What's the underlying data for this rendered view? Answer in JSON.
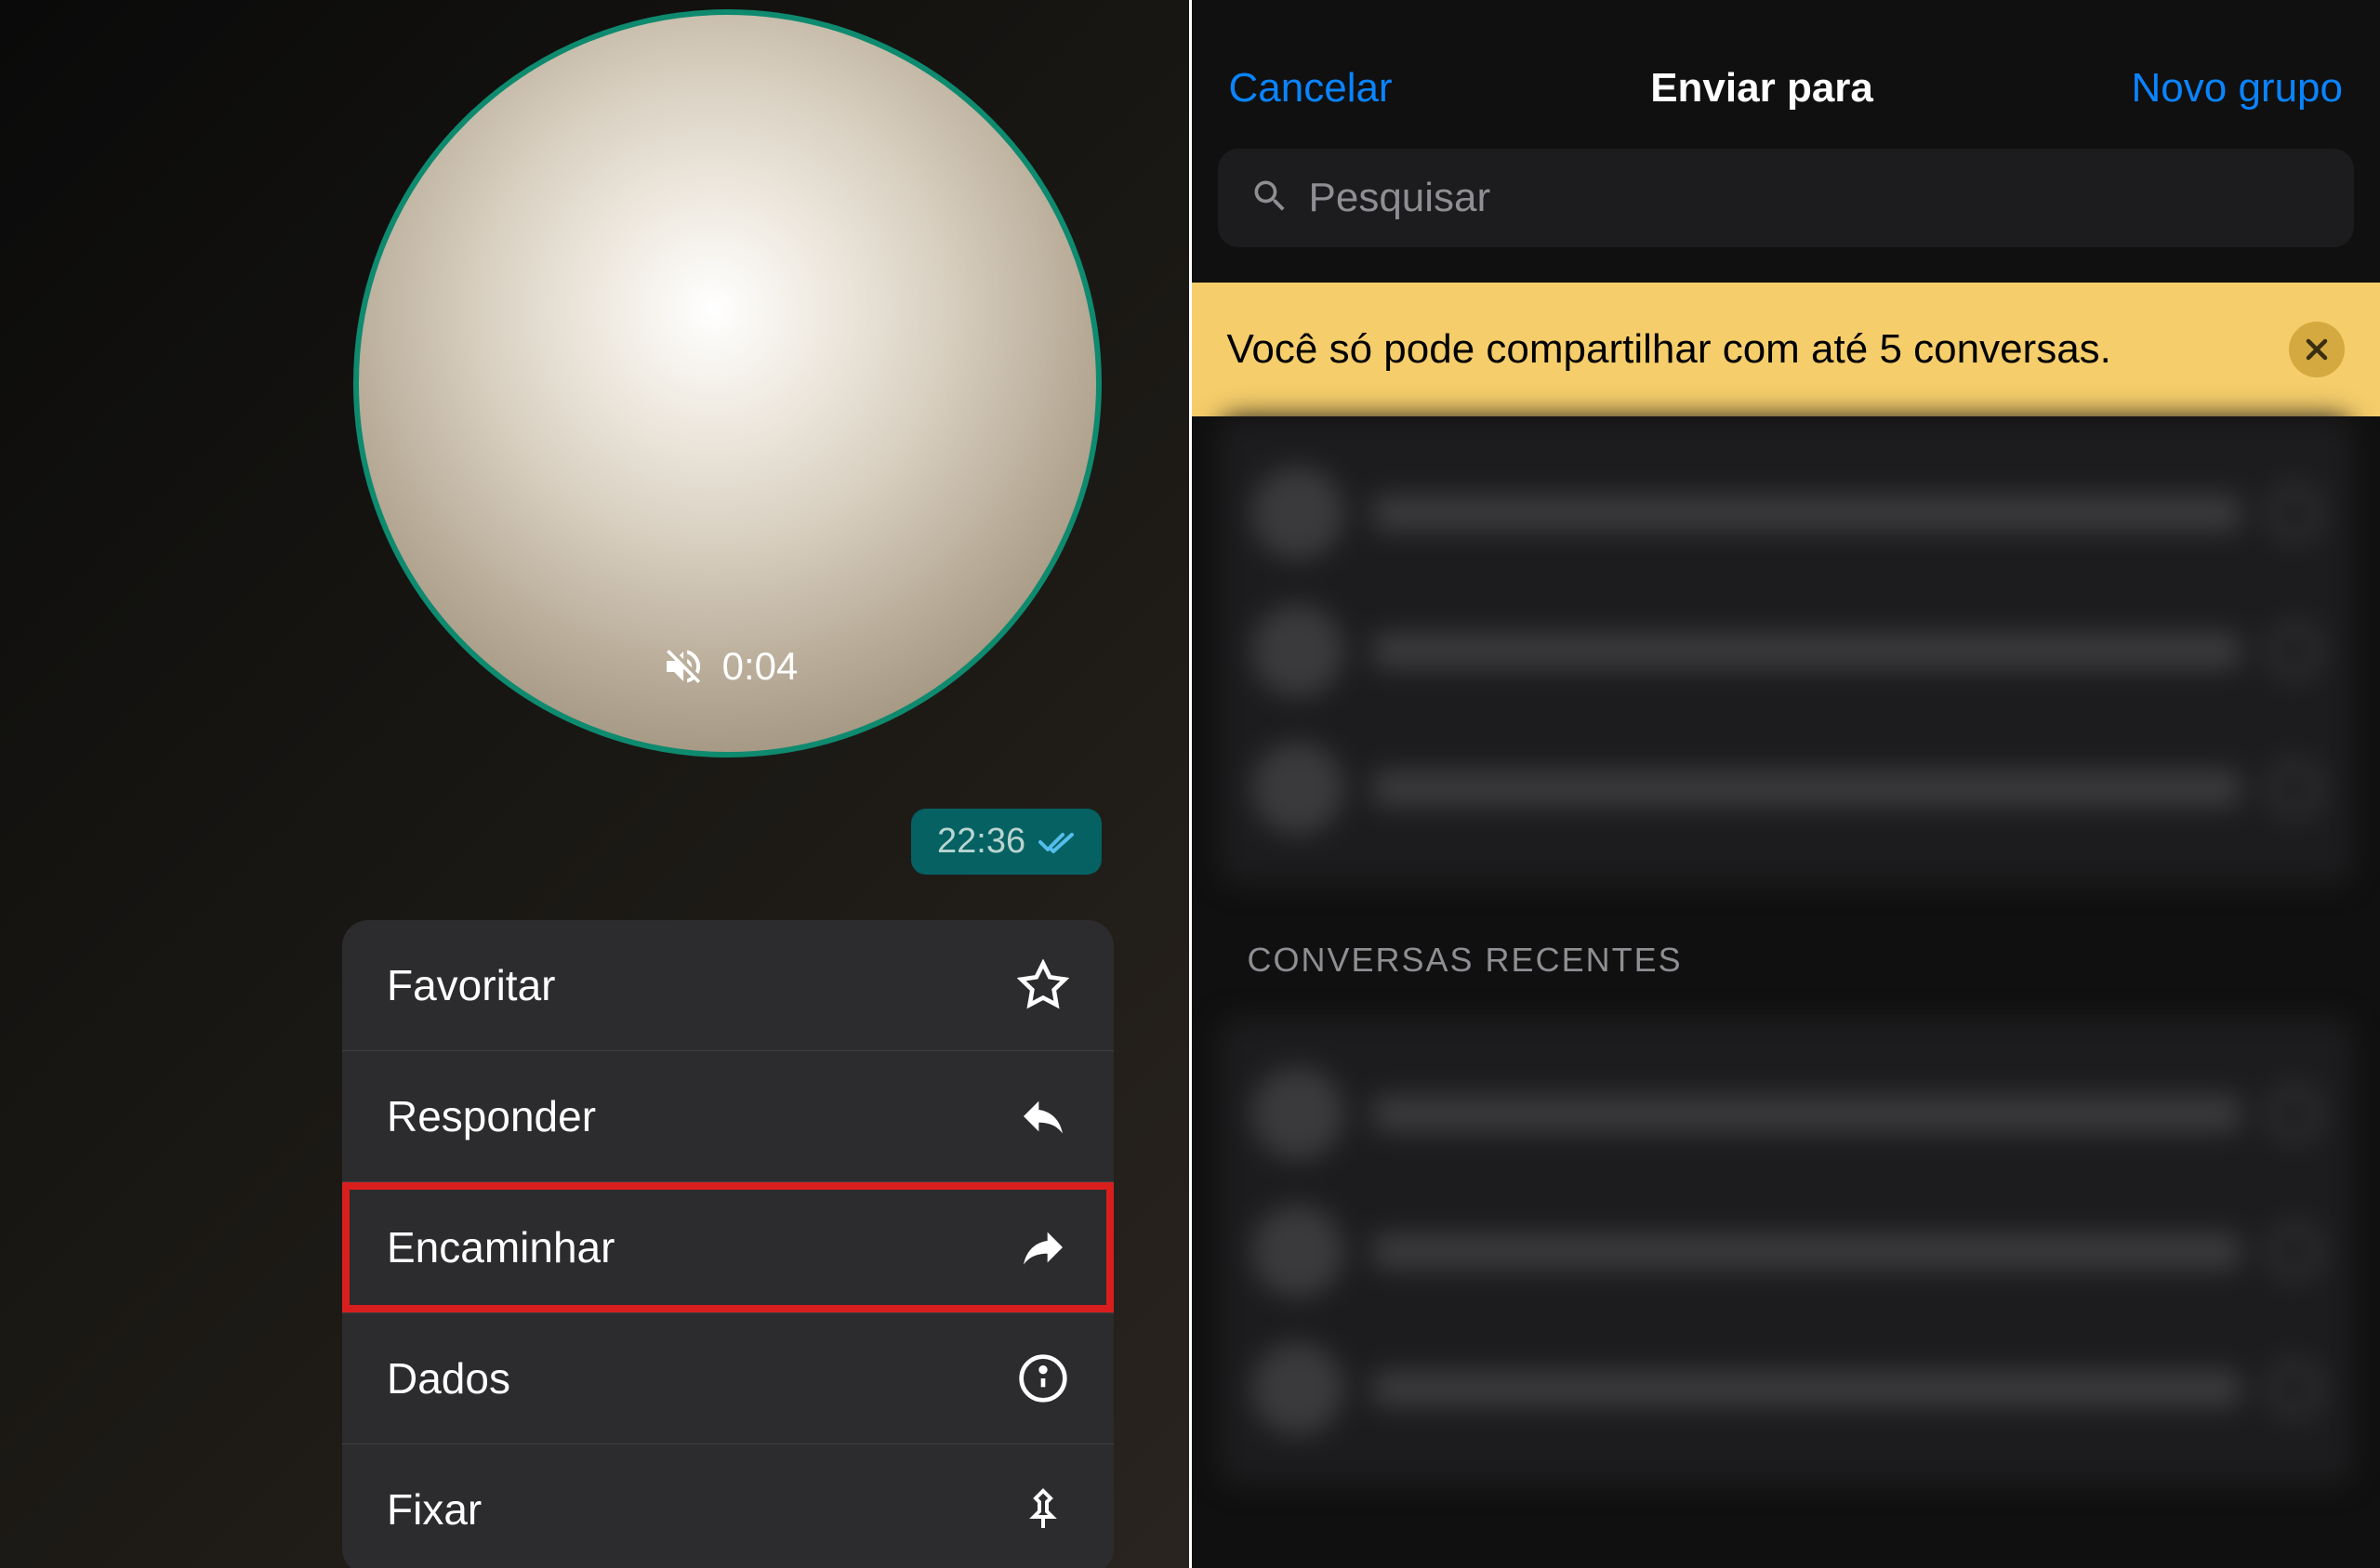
{
  "left": {
    "video_duration": "0:04",
    "message_time": "22:36",
    "menu": [
      {
        "label": "Favoritar",
        "icon": "star-icon",
        "highlighted": false
      },
      {
        "label": "Responder",
        "icon": "reply-icon",
        "highlighted": false
      },
      {
        "label": "Encaminhar",
        "icon": "forward-icon",
        "highlighted": true
      },
      {
        "label": "Dados",
        "icon": "info-icon",
        "highlighted": false
      },
      {
        "label": "Fixar",
        "icon": "pin-icon",
        "highlighted": false
      }
    ]
  },
  "right": {
    "header": {
      "cancel": "Cancelar",
      "title": "Enviar para",
      "new_group": "Novo grupo"
    },
    "search_placeholder": "Pesquisar",
    "banner_text": "Você só pode compartilhar com até 5 conversas.",
    "section_recent": "CONVERSAS RECENTES"
  }
}
